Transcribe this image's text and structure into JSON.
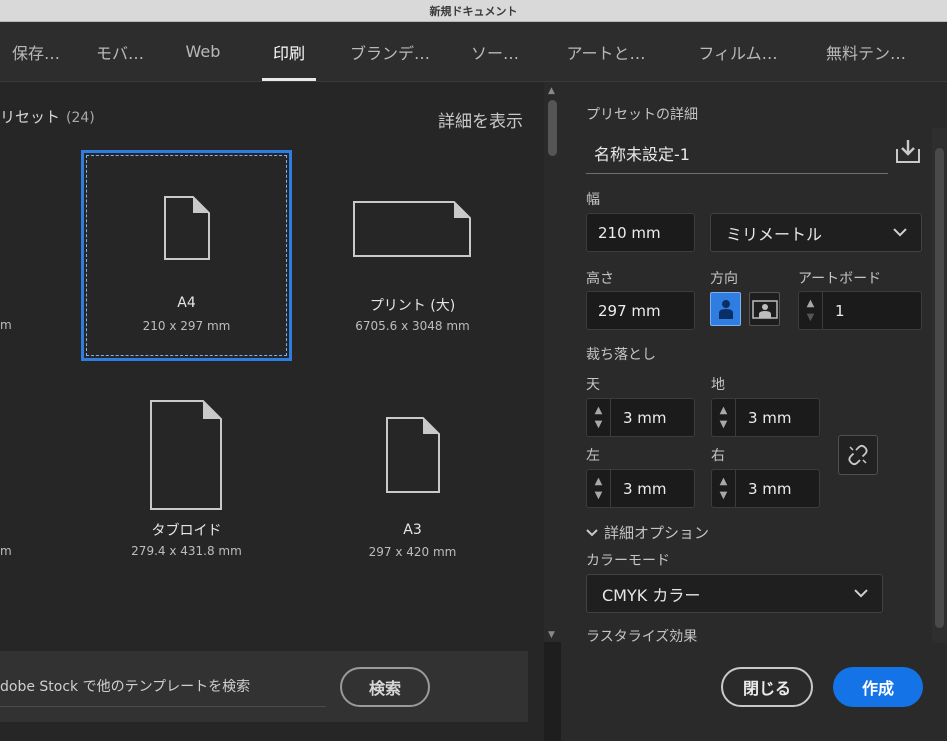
{
  "window": {
    "title": "新規ドキュメント"
  },
  "tabs": [
    {
      "label": "保存…",
      "active": false
    },
    {
      "label": "モバ…",
      "active": false
    },
    {
      "label": "Web",
      "active": false
    },
    {
      "label": "印刷",
      "active": true
    },
    {
      "label": "ブランデ…",
      "active": false
    },
    {
      "label": "ソー…",
      "active": false
    },
    {
      "label": "アートと…",
      "active": false
    },
    {
      "label": "フィルム…",
      "active": false
    },
    {
      "label": "無料テン…",
      "active": false
    }
  ],
  "presets": {
    "header": "リセット",
    "count": "(24)",
    "show_details": "詳細を表示",
    "partial_left_1": "m",
    "partial_left_2": "m",
    "items": [
      {
        "name": "A4",
        "size": "210 x 297 mm",
        "selected": true
      },
      {
        "name": "プリント (大)",
        "size": "6705.6 x 3048 mm",
        "selected": false
      },
      {
        "name": "タブロイド",
        "size": "279.4 x 431.8 mm",
        "selected": false
      },
      {
        "name": "A3",
        "size": "297 x 420 mm",
        "selected": false
      }
    ]
  },
  "search": {
    "text": "dobe Stock で他のテンプレートを検索",
    "button": "検索"
  },
  "details": {
    "title": "プリセットの詳細",
    "preset_name": "名称未設定-1",
    "width_label": "幅",
    "width_value": "210 mm",
    "unit_value": "ミリメートル",
    "height_label": "高さ",
    "height_value": "297 mm",
    "orientation_label": "方向",
    "artboard_label": "アートボード",
    "artboard_value": "1",
    "bleed_label": "裁ち落とし",
    "bleed_top_label": "天",
    "bleed_top": "3 mm",
    "bleed_bottom_label": "地",
    "bleed_bottom": "3 mm",
    "bleed_left_label": "左",
    "bleed_left": "3 mm",
    "bleed_right_label": "右",
    "bleed_right": "3 mm",
    "advanced_label": "詳細オプション",
    "color_mode_label": "カラーモード",
    "color_mode_value": "CMYK カラー",
    "raster_label": "ラスタライズ効果"
  },
  "footer": {
    "close": "閉じる",
    "create": "作成"
  },
  "colors": {
    "accent": "#1473e6",
    "selection": "#2f7de1"
  }
}
